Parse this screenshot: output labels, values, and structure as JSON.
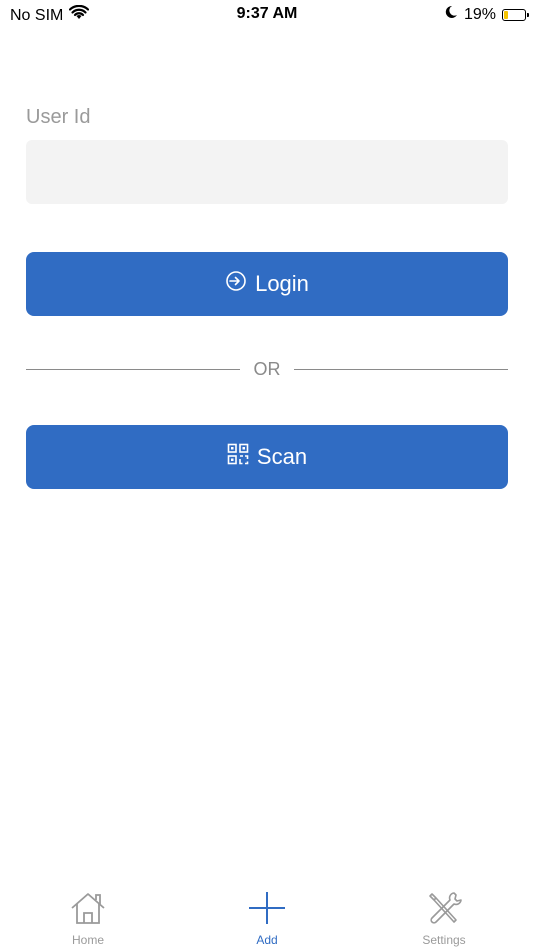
{
  "status_bar": {
    "carrier": "No SIM",
    "time": "9:37 AM",
    "battery_percent": "19%",
    "battery_level": 0.19,
    "icons": [
      "wifi-icon",
      "moon-icon",
      "battery-icon"
    ]
  },
  "form": {
    "user_id_label": "User Id",
    "user_id_value": "",
    "user_id_placeholder": ""
  },
  "buttons": {
    "login_label": "Login",
    "login_icon": "login-icon",
    "or_label": "OR",
    "scan_label": "Scan",
    "scan_icon": "qr-code-icon"
  },
  "tab_bar": {
    "tabs": [
      {
        "label": "Home",
        "icon": "home-icon",
        "active": false
      },
      {
        "label": "Add",
        "icon": "plus-icon",
        "active": true
      },
      {
        "label": "Settings",
        "icon": "tools-icon",
        "active": false
      }
    ]
  },
  "colors": {
    "accent": "#306cc3",
    "input_bg": "#f3f3f3",
    "muted_text": "#9a9a9a"
  }
}
